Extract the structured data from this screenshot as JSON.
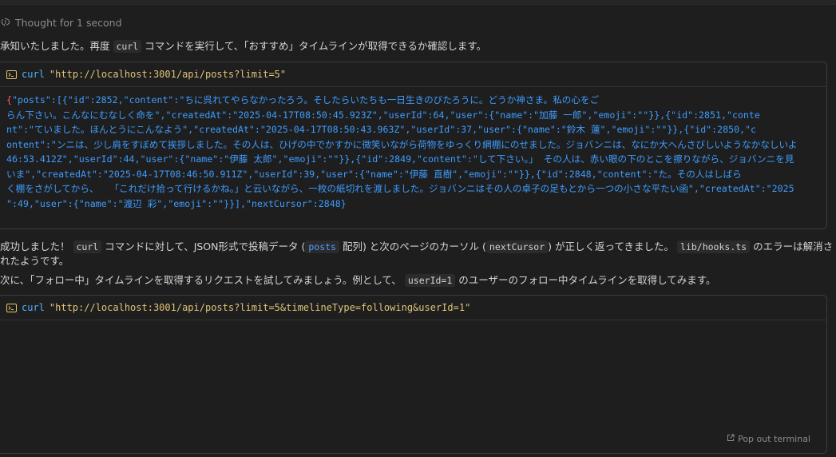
{
  "thought": {
    "label": "Thought for 1 second"
  },
  "intro": {
    "before": "承知いたしました。再度",
    "code": "curl",
    "after": "コマンドを実行して、「おすすめ」タイムラインが取得できるか確認します。"
  },
  "terminal1": {
    "command": "curl",
    "argument": "\"http://localhost:3001/api/posts?limit=5\"",
    "output_first_char": "{",
    "output_lines": [
      "\"posts\":[{\"id\":2852,\"content\":\"ちに呉れてやらなかったろう。そしたらいたちも一日生きのびたろうに。どうか神さま。私の心をご",
      "らん下さい。こんなにむなしく命を\",\"createdAt\":\"2025-04-17T08:50:45.923Z\",\"userId\":64,\"user\":{\"name\":\"加藤 一郎\",\"emoji\":\"\"}},{\"id\":2851,\"conte",
      "nt\":\"ていました。ほんとうにこんなよう\",\"createdAt\":\"2025-04-17T08:50:43.963Z\",\"userId\":37,\"user\":{\"name\":\"鈴木 蓮\",\"emoji\":\"\"}},{\"id\":2850,\"c",
      "ontent\":\"ンニは、少し肩をすぼめて挨拶しました。その人は、ひげの中でかすかに微笑いながら荷物をゆっくり網棚にのせました。ジョバンニは、なにか大へんさびしいようなかなしいよ",
      "46:53.412Z\",\"userId\":44,\"user\":{\"name\":\"伊藤 太郎\",\"emoji\":\"\"}},{\"id\":2849,\"content\":\"して下さい。」 その人は、赤い眼の下のとこを擦りながら、ジョバンニを見",
      "いま\",\"createdAt\":\"2025-04-17T08:46:50.911Z\",\"userId\":39,\"user\":{\"name\":\"伊藤 直樹\",\"emoji\":\"\"}},{\"id\":2848,\"content\":\"た。その人はしばら",
      "く棚をさがしてから、  「これだけ拾って行けるかね。」と云いながら、一枚の紙切れを渡しました。ジョバンニはその人の卓子の足もとから一つの小さな平たい函\",\"createdAt\":\"2025",
      "\":49,\"user\":{\"name\":\"渡辺 彩\",\"emoji\":\"\"}}],\"nextCursor\":2848}"
    ]
  },
  "success": {
    "p1": "成功しました！",
    "code1": "curl",
    "p2": "コマンドに対して、JSON形式で投稿データ (",
    "code2": "posts",
    "p3": " 配列) と次のページのカーソル (",
    "code3": "nextCursor",
    "p4": ") が正しく返ってきました。",
    "code4": "lib/hooks.ts",
    "p5": " のエラーは解",
    "p6": "消されたようです。"
  },
  "next": {
    "before": "次に、「フォロー中」タイムラインを取得するリクエストを試してみましょう。例として、",
    "code": "userId=1",
    "after": " のユーザーのフォロー中タイムラインを取得してみます。"
  },
  "terminal2": {
    "command": "curl",
    "argument": "\"http://localhost:3001/api/posts?limit=5&timelineType=following&userId=1\"",
    "popout_label": "Pop out terminal"
  }
}
